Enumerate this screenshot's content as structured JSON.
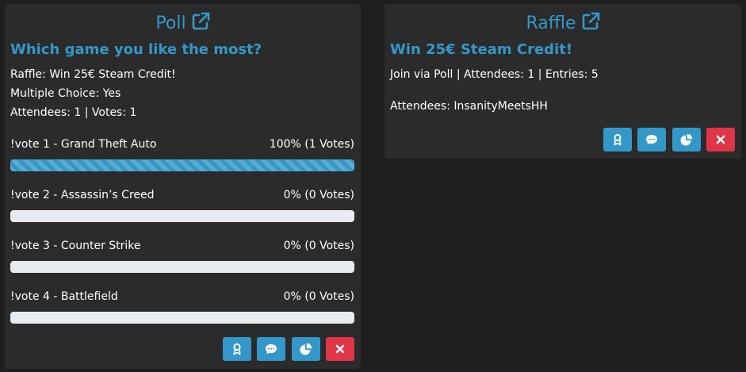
{
  "poll": {
    "header": "Poll",
    "question": "Which game you like the most?",
    "raffle_line": "Raffle: Win 25€ Steam Credit!",
    "multiple_choice_line": "Multiple Choice: Yes",
    "attendees_votes_line": "Attendees: 1 | Votes: 1",
    "options": [
      {
        "label": "!vote 1 - Grand Theft Auto",
        "result": "100% (1 Votes)",
        "percent": 100
      },
      {
        "label": "!vote 2 - Assassin’s Creed",
        "result": "0% (0 Votes)",
        "percent": 0
      },
      {
        "label": "!vote 3 - Counter Strike",
        "result": "0% (0 Votes)",
        "percent": 0
      },
      {
        "label": "!vote 4 - Battlefield",
        "result": "0% (0 Votes)",
        "percent": 0
      }
    ],
    "buttons": [
      "award-icon",
      "chat-icon",
      "pie-chart-icon",
      "close-icon"
    ]
  },
  "raffle": {
    "header": "Raffle",
    "title": "Win 25€ Steam Credit!",
    "summary_line": "Join via Poll | Attendees: 1 | Entries: 5",
    "attendees_line": "Attendees: InsanityMeetsHH",
    "buttons": [
      "award-icon",
      "chat-icon",
      "pie-chart-icon",
      "close-icon"
    ]
  },
  "colors": {
    "accent": "#3398c9",
    "danger": "#e03546",
    "card_bg": "#2b2b2b",
    "page_bg": "#1e1e1e",
    "bar_track": "#e9ecef"
  }
}
